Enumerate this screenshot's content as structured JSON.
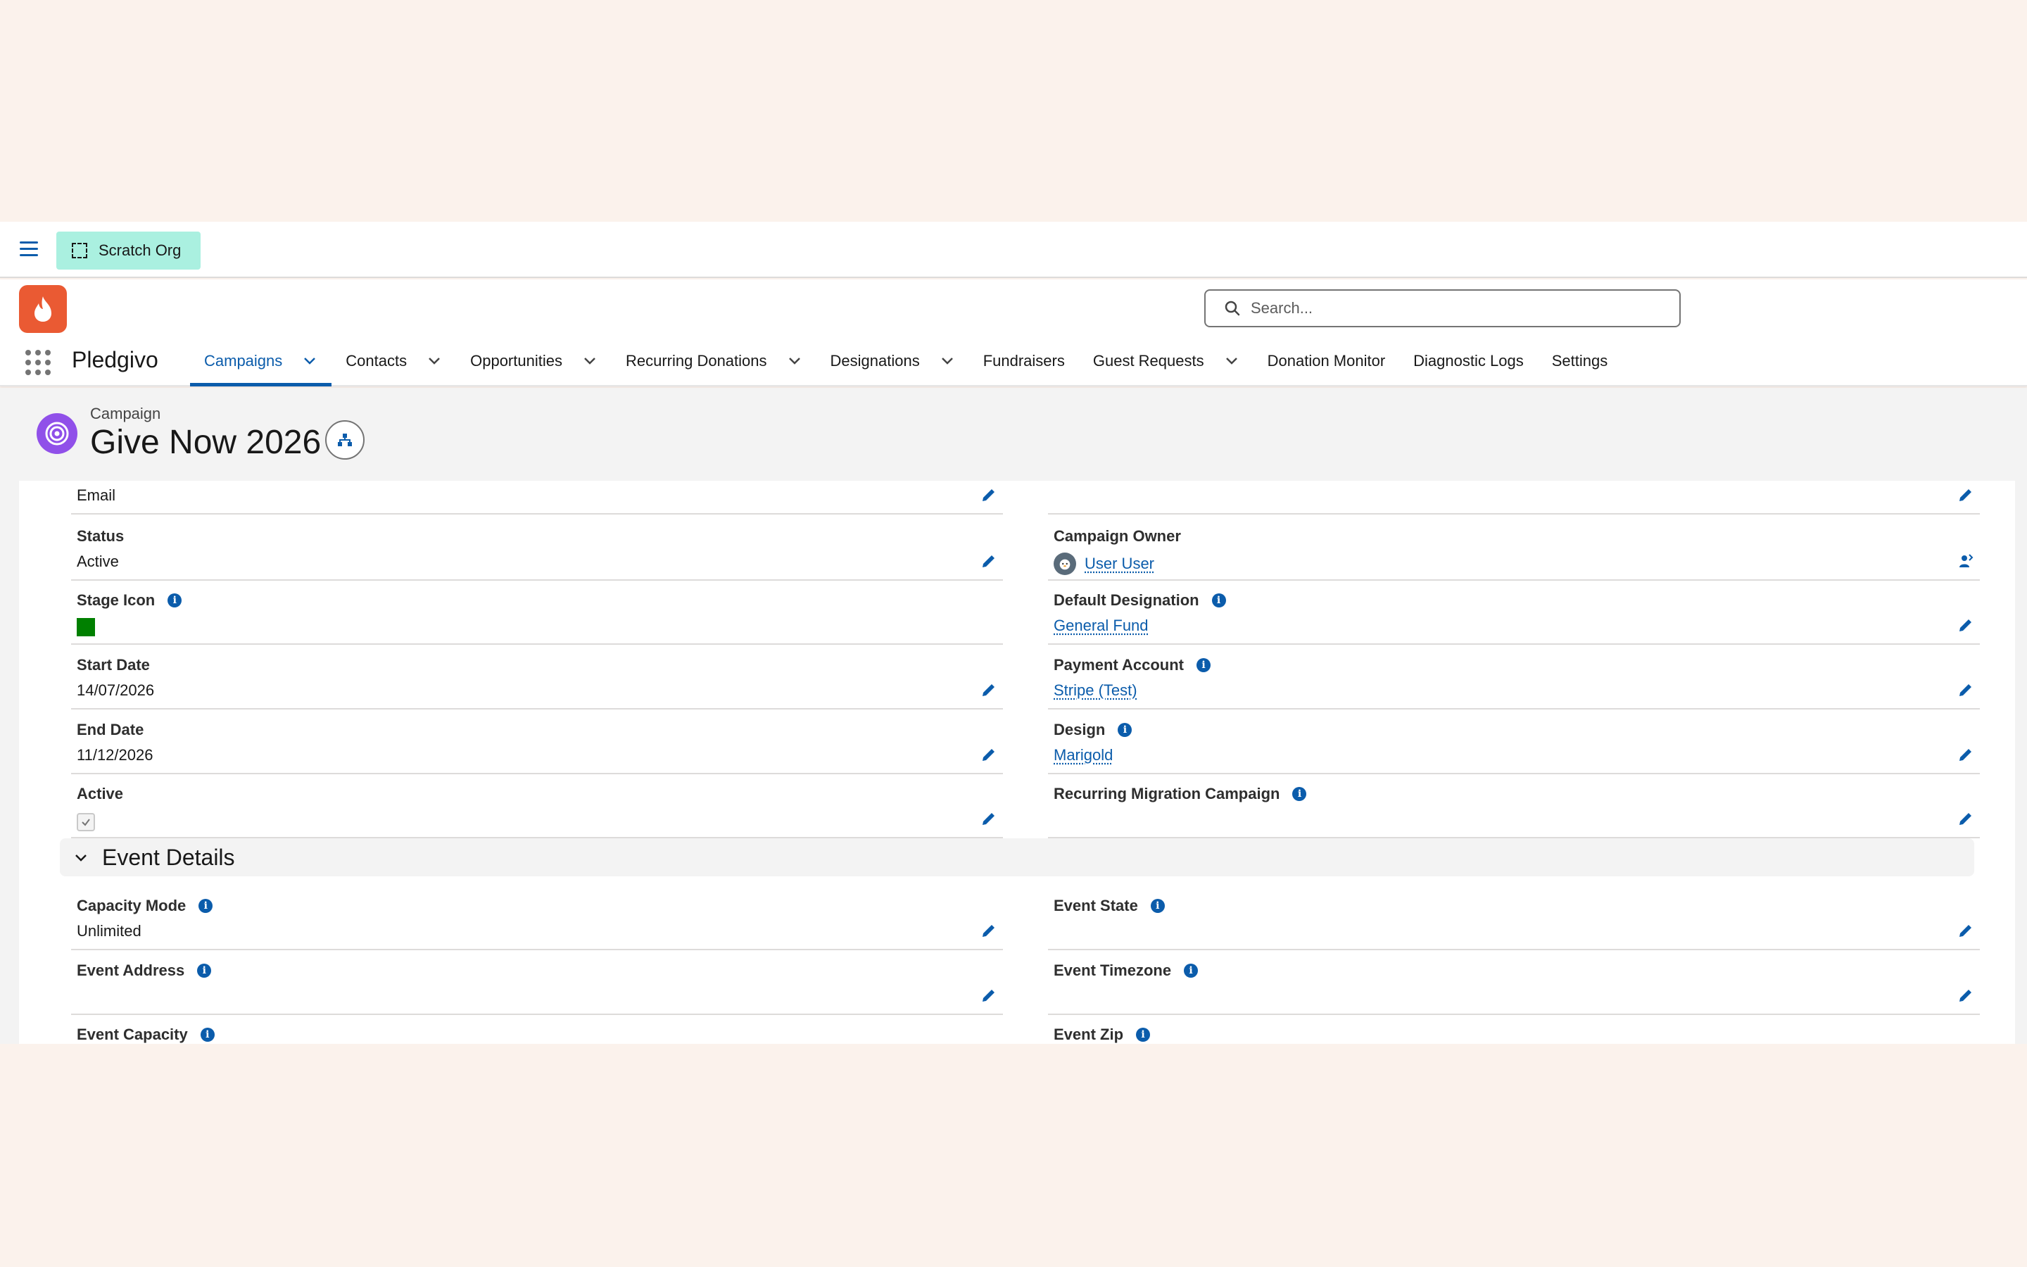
{
  "utility_bar": {
    "org_label": "Scratch Org"
  },
  "header": {
    "app_name": "Pledgivo",
    "search_placeholder": "Search...",
    "brand_color": "#ea5a33"
  },
  "nav": {
    "tabs": [
      {
        "label": "Campaigns",
        "active": true,
        "has_menu": true
      },
      {
        "label": "Contacts",
        "has_menu": true
      },
      {
        "label": "Opportunities",
        "has_menu": true
      },
      {
        "label": "Recurring Donations",
        "has_menu": true
      },
      {
        "label": "Designations",
        "has_menu": true
      },
      {
        "label": "Fundraisers",
        "has_menu": false
      },
      {
        "label": "Guest Requests",
        "has_menu": true
      },
      {
        "label": "Donation Monitor",
        "has_menu": false
      },
      {
        "label": "Diagnostic Logs",
        "has_menu": false
      },
      {
        "label": "Settings",
        "has_menu": false
      }
    ]
  },
  "record": {
    "object_label": "Campaign",
    "title": "Give Now 2026"
  },
  "fields_left": {
    "email": {
      "label": "Email"
    },
    "status": {
      "label": "Status",
      "value": "Active"
    },
    "stage_icon": {
      "label": "Stage Icon",
      "color": "#008000"
    },
    "start_date": {
      "label": "Start Date",
      "value": "14/07/2026"
    },
    "end_date": {
      "label": "End Date",
      "value": "11/12/2026"
    },
    "active": {
      "label": "Active",
      "checked": true
    }
  },
  "fields_right": {
    "campaign_owner": {
      "label": "Campaign Owner",
      "value": "User User"
    },
    "default_designation": {
      "label": "Default Designation",
      "value": "General Fund"
    },
    "payment_account": {
      "label": "Payment Account",
      "value": "Stripe (Test)"
    },
    "design": {
      "label": "Design",
      "value": "Marigold"
    },
    "recurring_migration_campaign": {
      "label": "Recurring Migration Campaign"
    }
  },
  "event_section": {
    "title": "Event Details",
    "capacity_mode": {
      "label": "Capacity Mode",
      "value": "Unlimited"
    },
    "event_address": {
      "label": "Event Address"
    },
    "event_capacity": {
      "label": "Event Capacity"
    },
    "event_state": {
      "label": "Event State"
    },
    "event_timezone": {
      "label": "Event Timezone"
    },
    "event_zip": {
      "label": "Event Zip"
    }
  },
  "info_glyph": "i"
}
